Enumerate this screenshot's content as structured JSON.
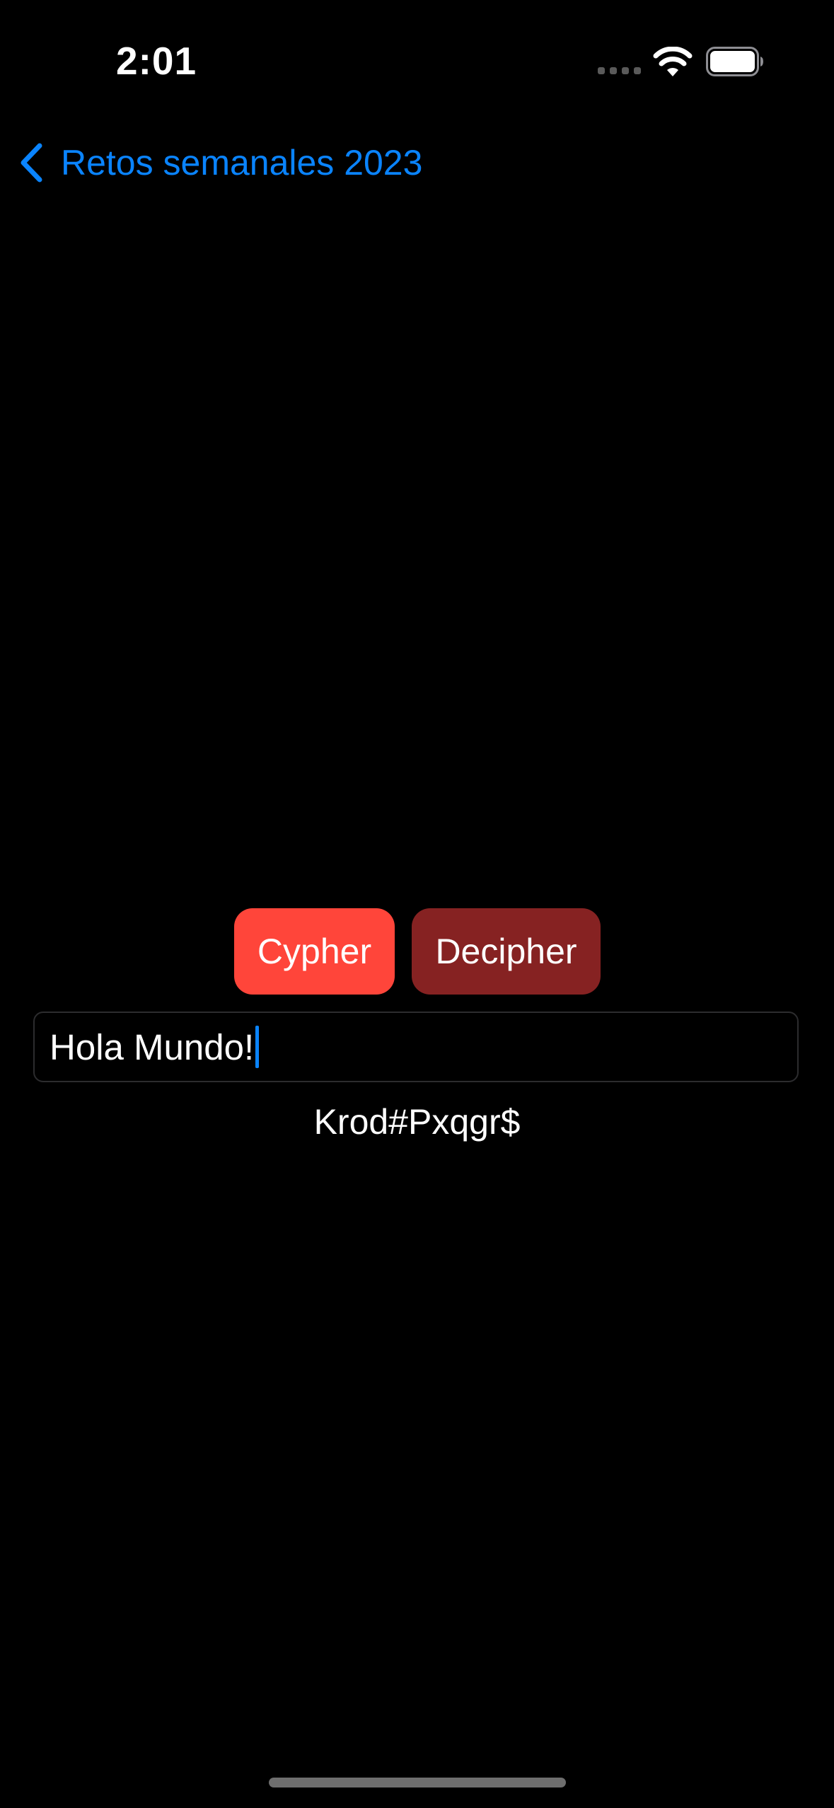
{
  "status_bar": {
    "time": "2:01",
    "icons": [
      "cellular-signal-icon",
      "wifi-icon",
      "battery-icon"
    ]
  },
  "nav": {
    "back_label": "Retos semanales 2023",
    "back_icon": "chevron-left-icon",
    "accent_color": "#0a84ff"
  },
  "actions": {
    "cypher_label": "Cypher",
    "cypher_color": "#ff453a",
    "decipher_label": "Decipher",
    "decipher_color": "#862222"
  },
  "input": {
    "value": "Hola Mundo!",
    "focused": true
  },
  "output": {
    "result": "Krod#Pxqgr$"
  }
}
